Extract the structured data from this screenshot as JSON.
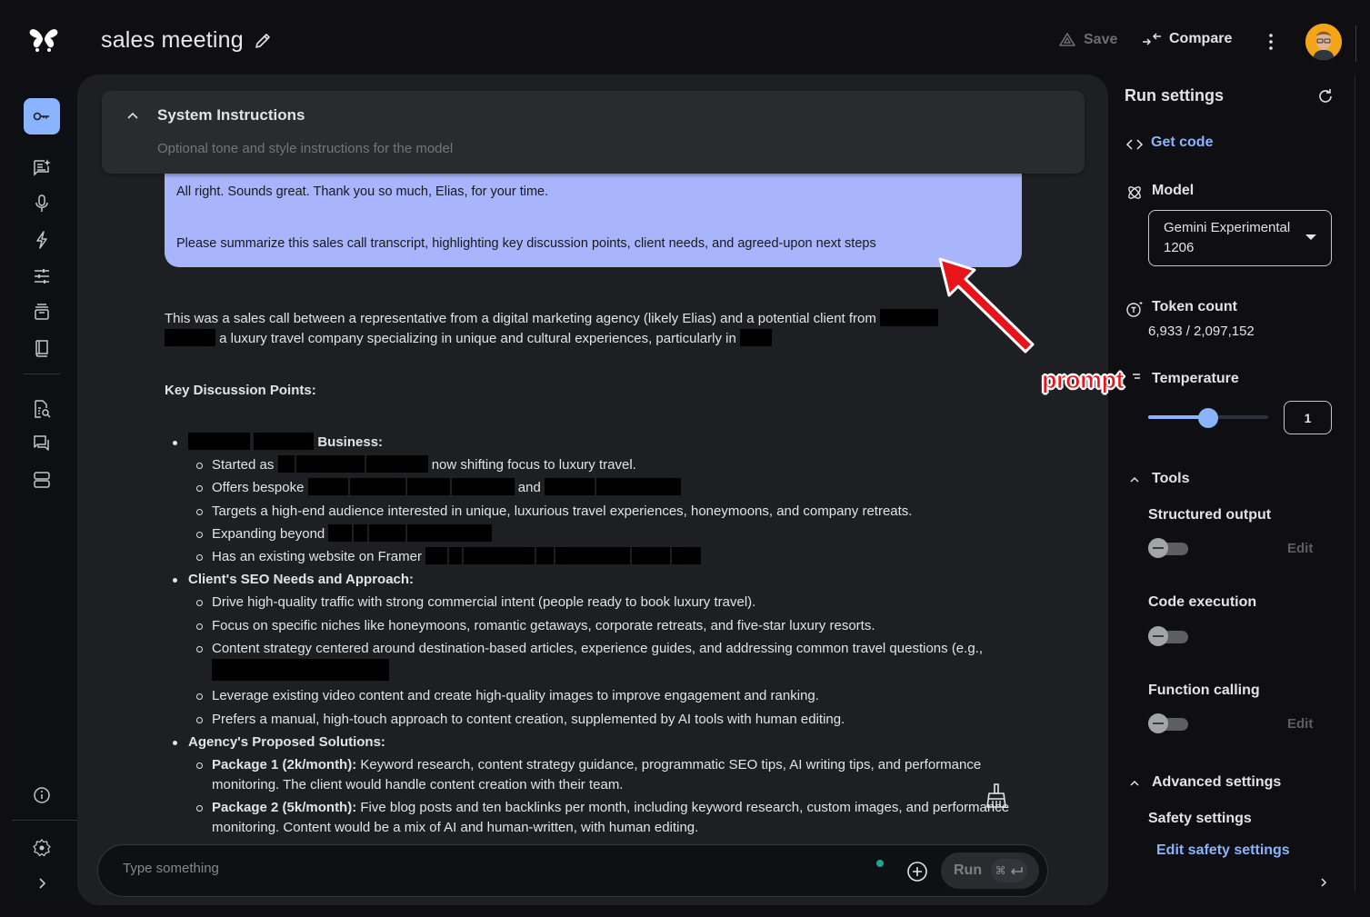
{
  "header": {
    "title": "sales meeting",
    "save_label": "Save",
    "compare_label": "Compare"
  },
  "system_instructions": {
    "title": "System Instructions",
    "placeholder": "Optional tone and style instructions for the model"
  },
  "user_message": {
    "line1": "All right. Sounds great. Thank you so much, Elias, for your time.",
    "line2": "Please summarize this sales call transcript, highlighting key discussion points, client needs, and agreed-upon next steps"
  },
  "response": {
    "intro_a": "This was a sales call between a representative from a digital marketing agency (likely Elias) and a potential client from",
    "intro_b": "a luxury travel company specializing in unique and cultural experiences, particularly in",
    "heading": "Key Discussion Points:",
    "sections": [
      {
        "title": "Business:",
        "items": [
          {
            "pre": "Started as",
            "post": "now shifting focus to luxury travel."
          },
          {
            "pre": "Offers bespoke",
            "mid": "and",
            "post": ""
          },
          {
            "pre": "Targets a high-end audience interested in unique, luxurious travel experiences, honeymoons, and company retreats."
          },
          {
            "pre": "Expanding beyond"
          },
          {
            "pre": "Has an existing website on Framer"
          }
        ]
      },
      {
        "title": "Client's SEO Needs and Approach:",
        "items": [
          {
            "pre": "Drive high-quality traffic with strong commercial intent (people ready to book luxury travel)."
          },
          {
            "pre": "Focus on specific niches like honeymoons, romantic getaways, corporate retreats, and five-star luxury resorts."
          },
          {
            "pre": "Content strategy centered around destination-based articles, experience guides, and addressing common travel questions (e.g.,"
          },
          {
            "pre": "Leverage existing video content and create high-quality images to improve engagement and ranking."
          },
          {
            "pre": "Prefers a manual, high-touch approach to content creation, supplemented by AI tools with human editing."
          }
        ]
      },
      {
        "title": "Agency's Proposed Solutions:",
        "items": [
          {
            "bold": "Package 1 (2k/month):",
            "pre": " Keyword research, content strategy guidance, programmatic SEO tips, AI writing tips, and performance monitoring. The client would handle content creation with their team."
          },
          {
            "bold": "Package 2 (5k/month):",
            "pre": " Five blog posts and ten backlinks per month, including keyword research, custom images, and performance monitoring. Content would be a mix of AI and human-written, with human editing."
          }
        ]
      }
    ]
  },
  "composer": {
    "placeholder": "Type something",
    "run_label": "Run",
    "shortcut": "⌘"
  },
  "run_settings": {
    "title": "Run settings",
    "get_code": "Get code",
    "model_label": "Model",
    "model_value_line1": "Gemini Experimental",
    "model_value_line2": "1206",
    "token_label": "Token count",
    "token_value": "6,933 / 2,097,152",
    "temperature_label": "Temperature",
    "temperature_value": "1",
    "temperature_fraction": 0.5,
    "tools_label": "Tools",
    "structured_output": "Structured output",
    "code_execution": "Code execution",
    "function_calling": "Function calling",
    "edit_label": "Edit",
    "advanced_label": "Advanced settings",
    "safety_label": "Safety settings",
    "safety_link": "Edit safety settings"
  },
  "annotation": {
    "label": "prompt",
    "color": "#e8141b"
  },
  "colors": {
    "accent": "#8ab4ff",
    "user_bubble": "#a8b4fc"
  }
}
